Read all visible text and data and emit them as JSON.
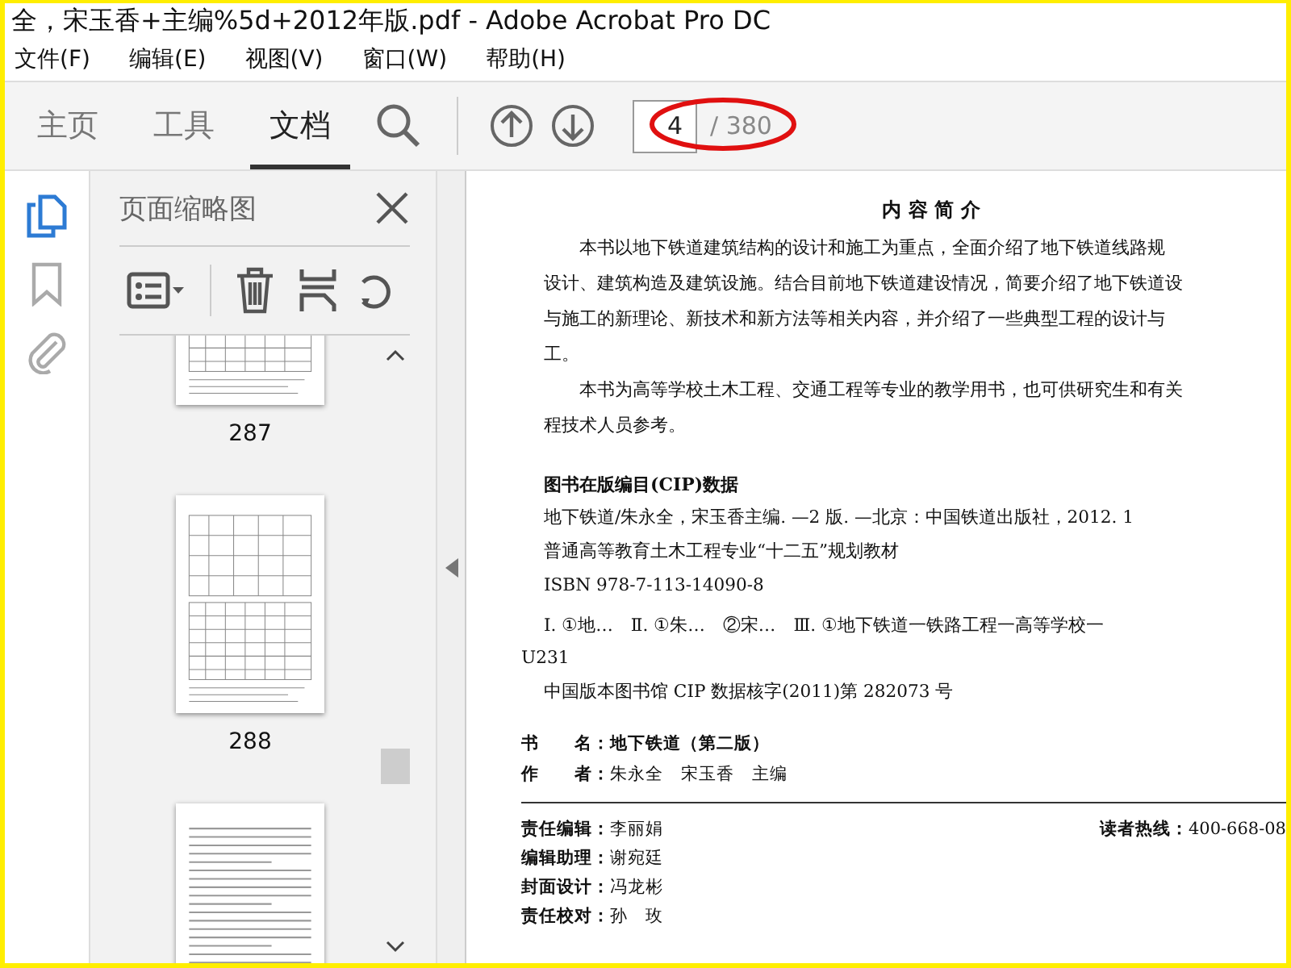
{
  "window": {
    "title": "全，宋玉香+主编%5d+2012年版.pdf - Adobe Acrobat Pro DC"
  },
  "menu": [
    "文件(F)",
    "编辑(E)",
    "视图(V)",
    "窗口(W)",
    "帮助(H)"
  ],
  "tabs": [
    {
      "label": "主页",
      "selected": false
    },
    {
      "label": "工具",
      "selected": false
    },
    {
      "label": "文档",
      "selected": true
    }
  ],
  "page_nav": {
    "current": "4",
    "total": "/ 380"
  },
  "side_rail": [
    {
      "kind": "pages",
      "selected": true
    },
    {
      "kind": "bookmarks",
      "selected": false
    },
    {
      "kind": "attachments",
      "selected": false
    }
  ],
  "thumbnail_panel": {
    "title": "页面缩略图",
    "thumbnails": [
      {
        "label": "287",
        "kind": "table",
        "selected": false
      },
      {
        "label": "288",
        "kind": "table",
        "selected": false
      },
      {
        "kind": "text",
        "selected": false
      }
    ]
  },
  "document": {
    "heading": "内 容 简 介",
    "summary": [
      [
        "本书以地下铁道建筑结构的设计和施工为重点，全面介绍了地下铁道线路规",
        "设计、建筑构造及建筑设施。结合目前地下铁道建设情况，简要介绍了地下铁道设",
        "与施工的新理论、新技术和新方法等相关内容，并介绍了一些典型工程的设计与",
        "工。"
      ],
      [
        "本书为高等学校土木工程、交通工程等专业的教学用书，也可供研究生和有关",
        "程技术人员参考。"
      ]
    ],
    "cip_heading": "图书在版编目(CIP)数据",
    "cip_lines": [
      "地下铁道/朱永全，宋玉香主编. —2 版. —北京：中国铁道出版社，2012. 1",
      "普通高等教育土木工程专业“十二五”规划教材",
      "ISBN 978-7-113-14090-8"
    ],
    "classification": "Ⅰ. ①地…　Ⅱ. ①朱…　②宋…　Ⅲ. ①地下铁道一铁路工程一高等学校一",
    "class_number": "U231",
    "cip_number": "中国版本图书馆 CIP 数据核字(2011)第 282073 号",
    "book_info": [
      "**书　　名：地下铁道（第二版）**",
      "**作　　者：**朱永全　宋玉香　主编"
    ],
    "credits": [
      "**责任编辑：**李丽娟",
      "**编辑助理：**谢宛廷",
      "**封面设计：**冯龙彬",
      "**责任校对：**孙　玫"
    ],
    "hotline": "**读者热线：**400-668-08"
  }
}
